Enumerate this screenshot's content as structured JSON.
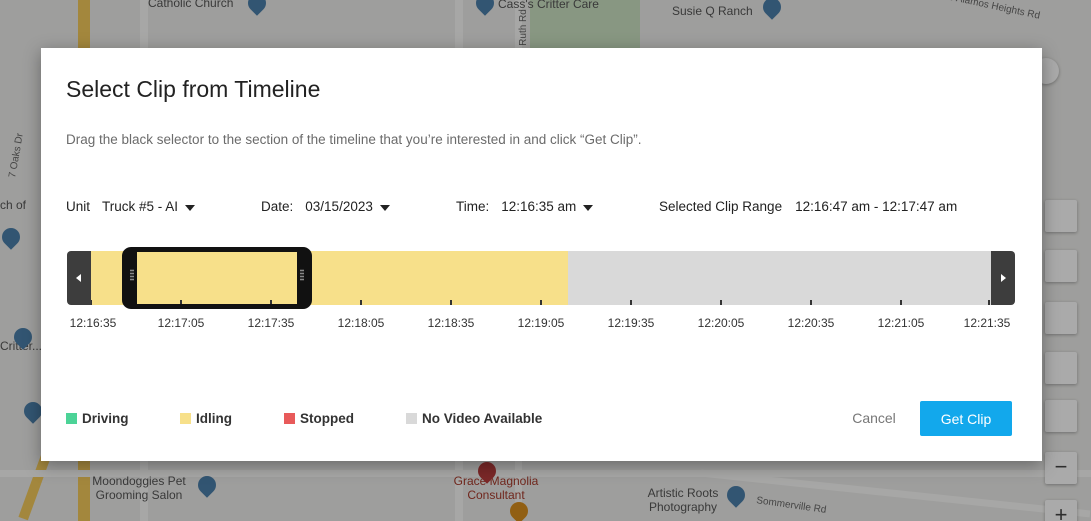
{
  "map": {
    "labels": {
      "catholic_church": "Catholic Church",
      "crittercare": "Cass's Critter Care",
      "susie_q": "Susie Q Ranch",
      "los_alamos": "Los Alamos Heights Rd",
      "oaks_dr": "7 Oaks Dr",
      "ruth_rd": "Ruth Rd",
      "moondoggies": "Moondoggies Pet Grooming Salon",
      "grace_magnolia": "Grace Magnolia Consultant",
      "artistic_roots": "Artistic Roots Photography",
      "sommerville": "Sommerville Rd",
      "church_of": "ch of",
      "critter": "Critter..."
    },
    "zoom_out_symbol": "−",
    "zoom_in_symbol": "+"
  },
  "modal": {
    "title": "Select Clip from Timeline",
    "description": "Drag the black selector to the section of the timeline that you’re interested in and click “Get Clip”.",
    "unit": {
      "label": "Unit",
      "value": "Truck #5 - AI"
    },
    "date": {
      "label": "Date:",
      "value": "03/15/2023"
    },
    "time": {
      "label": "Time:",
      "value": "12:16:35 am"
    },
    "clip_range": {
      "label": "Selected Clip Range",
      "value": "12:16:47 am - 12:17:47 am"
    },
    "timeline": {
      "tick_labels": [
        "12:16:35",
        "12:17:05",
        "12:17:35",
        "12:18:05",
        "12:18:35",
        "12:19:05",
        "12:19:35",
        "12:20:05",
        "12:20:35",
        "12:21:05",
        "12:21:35"
      ],
      "segments": [
        {
          "status": "idling",
          "start": 0,
          "end": 0.53
        },
        {
          "status": "no_video",
          "start": 0.5833,
          "end": 0.5889
        }
      ],
      "selection": {
        "start": 0.04,
        "end": 0.24
      }
    },
    "legend": [
      {
        "key": "driving",
        "label": "Driving",
        "color": "#4cd397"
      },
      {
        "key": "idling",
        "label": "Idling",
        "color": "#f7e08a"
      },
      {
        "key": "stopped",
        "label": "Stopped",
        "color": "#e85a5a"
      },
      {
        "key": "no_video",
        "label": "No Video Available",
        "color": "#d9d9d9"
      }
    ],
    "buttons": {
      "cancel": "Cancel",
      "get_clip": "Get Clip"
    }
  }
}
